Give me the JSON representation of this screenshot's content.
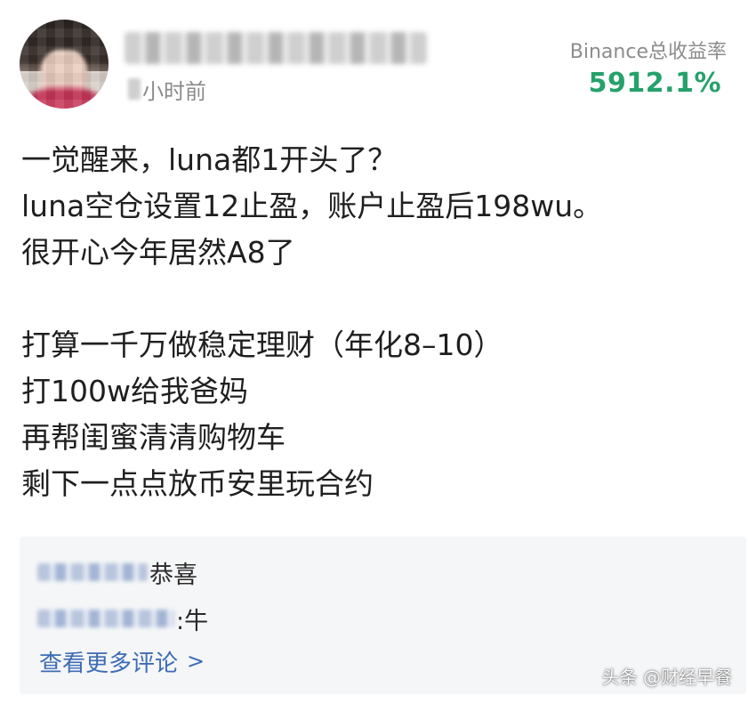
{
  "post": {
    "time_suffix": "小时前",
    "stat_label": "Binance总收益率",
    "stat_value": "5912.1%",
    "lines": [
      "一觉醒来，luna都1开头了？",
      "luna空仓设置12止盈，账户止盈后198wu。",
      "很开心今年居然A8了",
      "打算一千万做稳定理财（年化8–10）",
      "打100w给我爸妈",
      "再帮闺蜜清清购物车",
      "剩下一点点放币安里玩合约"
    ]
  },
  "comments": [
    {
      "text": "恭喜"
    },
    {
      "text": ":牛"
    }
  ],
  "more_comments_label": "查看更多评论",
  "more_comments_icon": "chevron-right-icon",
  "watermark": "头条 @财经早餐",
  "colors": {
    "stat_green": "#25a16b",
    "link_blue": "#3d6cb5",
    "panel_bg": "#f5f6f8"
  }
}
